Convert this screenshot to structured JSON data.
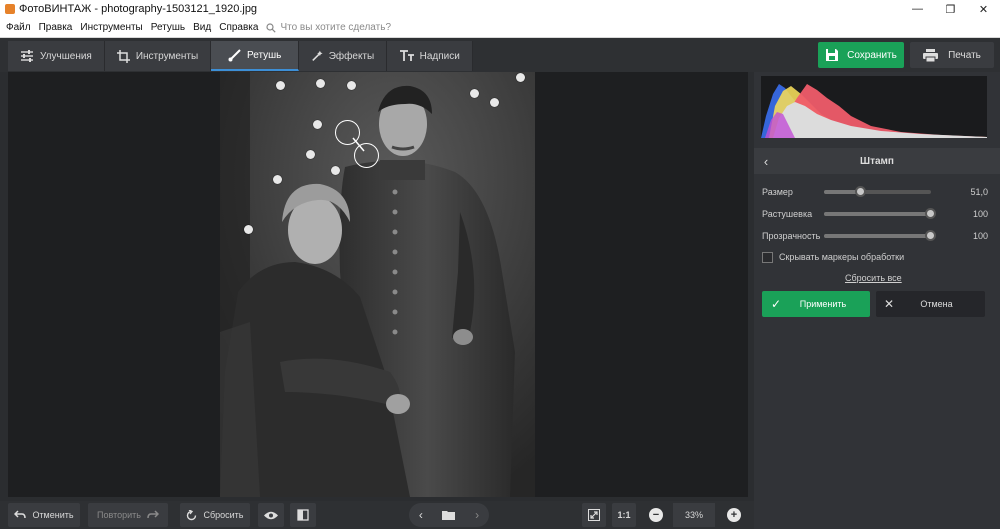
{
  "window": {
    "title": "ФотоВИНТАЖ - photography-1503121_1920.jpg",
    "minimize": "—",
    "restore": "❐",
    "close": "✕"
  },
  "menu": {
    "items": [
      "Файл",
      "Правка",
      "Инструменты",
      "Ретушь",
      "Вид",
      "Справка"
    ],
    "search_placeholder": "Что вы хотите сделать?"
  },
  "tabs": [
    {
      "label": "Улучшения",
      "icon": "sliders-icon"
    },
    {
      "label": "Инструменты",
      "icon": "crop-icon"
    },
    {
      "label": "Ретушь",
      "icon": "brush-icon",
      "active": true
    },
    {
      "label": "Эффекты",
      "icon": "magic-wand-icon"
    },
    {
      "label": "Надписи",
      "icon": "text-icon"
    }
  ],
  "actions": {
    "save_label": "Сохранить",
    "print_label": "Печать"
  },
  "panel": {
    "title": "Штамп",
    "back_icon": "chevron-left-icon",
    "sliders": [
      {
        "label": "Размер",
        "value": "51,0",
        "position": 0.35
      },
      {
        "label": "Растушевка",
        "value": "100",
        "position": 1.0
      },
      {
        "label": "Прозрачность",
        "value": "100",
        "position": 1.0
      }
    ],
    "hide_markers_label": "Скрывать маркеры обработки",
    "hide_markers_checked": false,
    "reset_all_label": "Сбросить все",
    "apply_label": "Применить",
    "cancel_label": "Отмена"
  },
  "bottom": {
    "undo_label": "Отменить",
    "redo_label": "Повторить",
    "reset_label": "Сбросить",
    "zoom_fit_label": "1:1",
    "zoom_value": "33%",
    "zoom_out": "−",
    "zoom_in": "+"
  },
  "colors": {
    "accent_green": "#1aa158",
    "active_tab_underline": "#3d8fd6",
    "background": "#2b2d30"
  }
}
